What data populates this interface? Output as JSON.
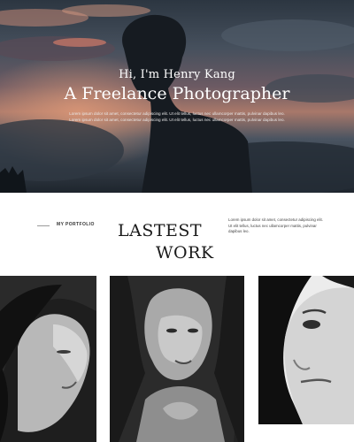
{
  "hero": {
    "greeting": "Hi, I'm Henry Kang",
    "title": "A Freelance Photographer",
    "description": "Lorem ipsum dolor sit amet, consectetur adipiscing elit. Ut elit tellus, luctus nec ullamcorper mattis, pulvinar dapibus leo. Lorem ipsum dolor sit amet, consectetur adipiscing elit. Ut elit tellus, luctus nec ullamcorper mattis, pulvinar dapibus leo."
  },
  "portfolio": {
    "label": "MY PORTFOLIO",
    "heading_line1": "LASTEST",
    "heading_line2": "WORK",
    "description": "Lorem ipsum dolor sit amet, consectetur adipiscing elit. Ut elit tellus, luctus nec ullamcorper mattis, pulvinar dapibus leo."
  },
  "colors": {
    "text_dark": "#1a1a1a",
    "hero_text": "#ffffff",
    "background": "#ffffff"
  }
}
